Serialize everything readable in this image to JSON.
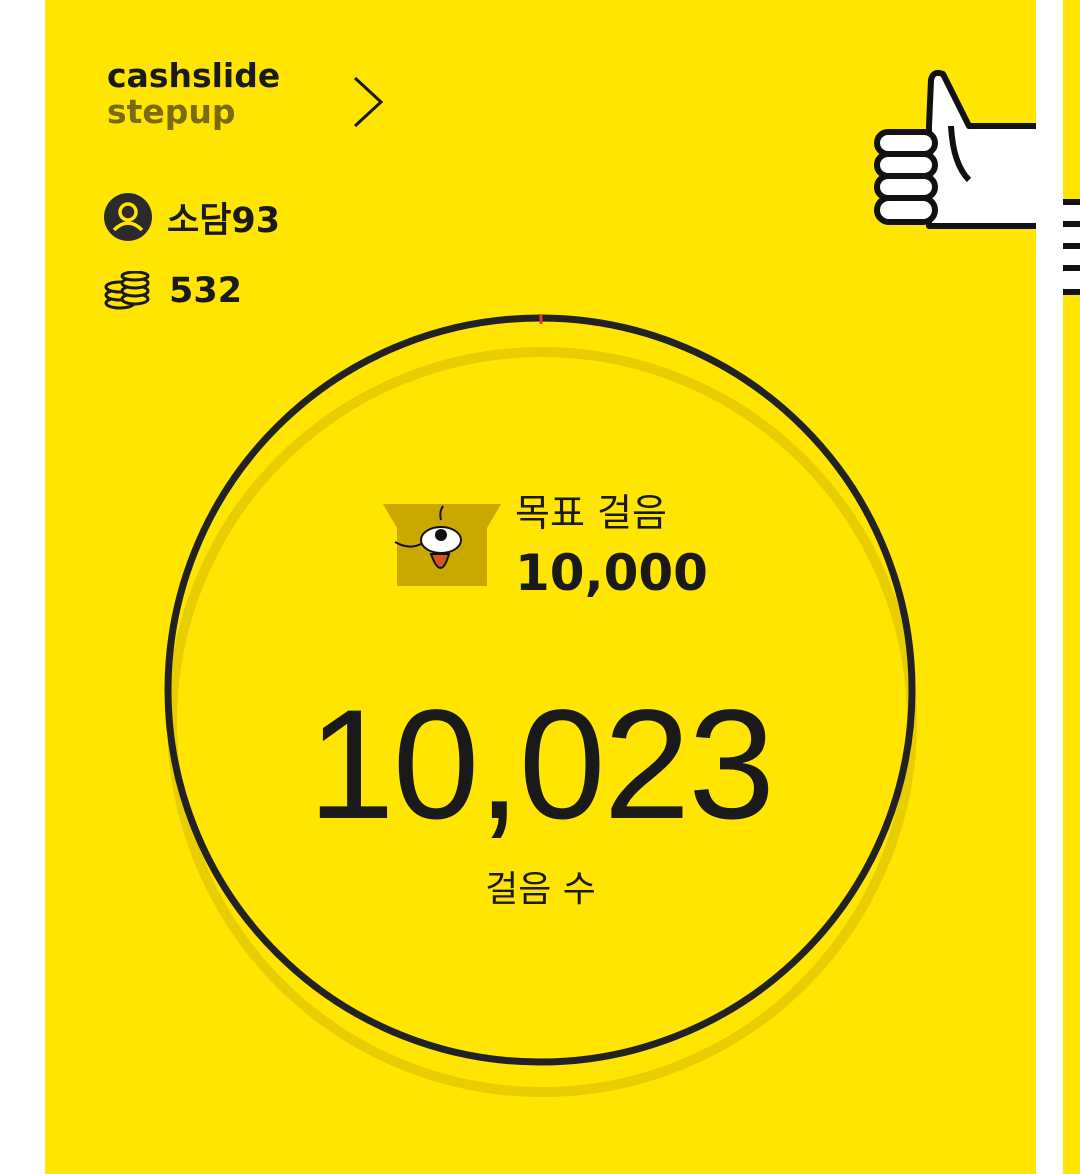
{
  "brand": {
    "line1": "cashslide",
    "line2": "stepup"
  },
  "user": {
    "nickname": "소담93",
    "icon": "user-circle-icon"
  },
  "wallet": {
    "points": "532",
    "icon": "coin-stack-icon"
  },
  "goal": {
    "label": "목표 걸음",
    "value": "10,000"
  },
  "steps": {
    "count": "10,023",
    "label": "걸음 수"
  },
  "progress": {
    "fraction": 1.0023
  },
  "colors": {
    "background": "#FFE500",
    "text": "#1a1a1a",
    "brand_secondary": "#7a6a12",
    "ring": "#222222",
    "progress_marker": "#E53935",
    "mascot": "#C9A800"
  },
  "icons": {
    "brand_arrow": "chevron-right-icon",
    "mascot": "dog-mascot-icon",
    "thumb": "thumbs-up-icon"
  }
}
